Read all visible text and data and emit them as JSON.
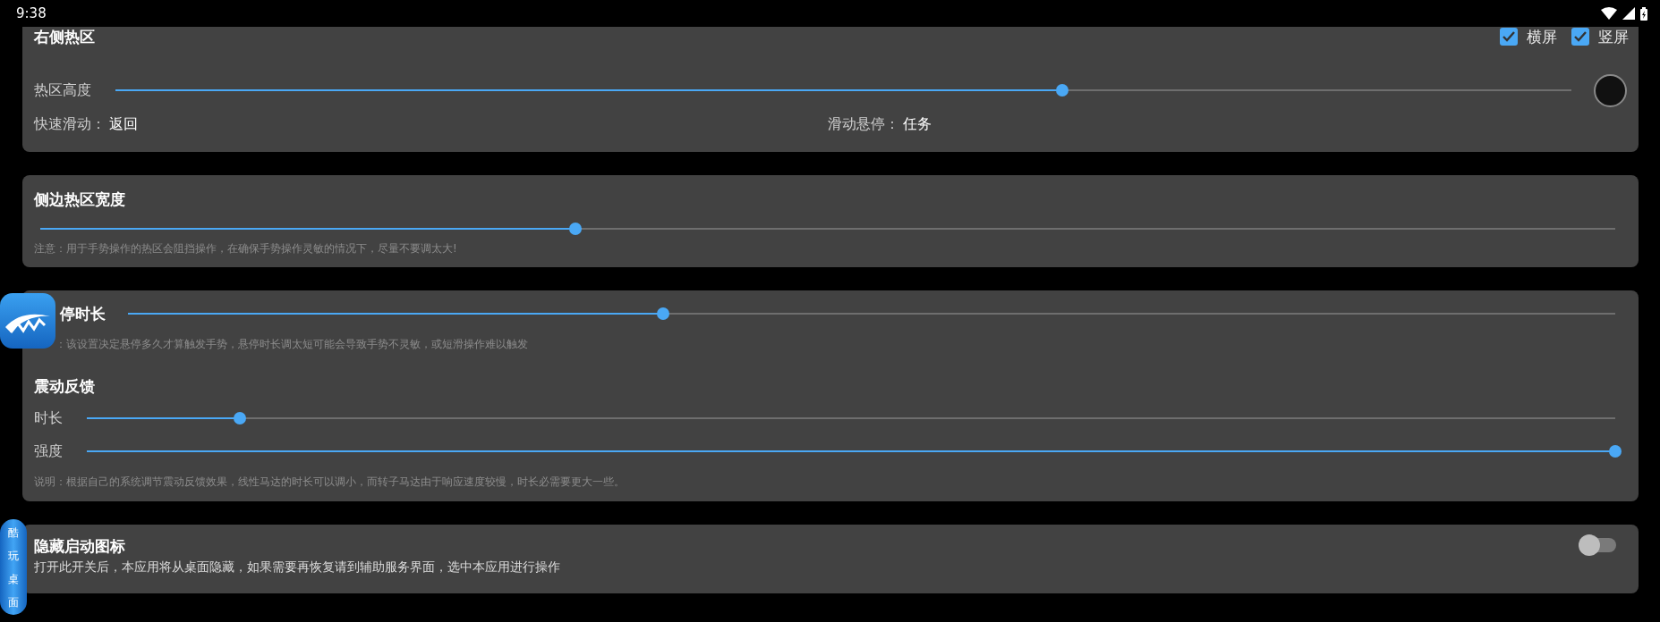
{
  "status_bar": {
    "time": "9:38"
  },
  "cards": [
    {
      "rows": [
        {
          "kind": "header",
          "title": "右侧热区",
          "checkboxes": [
            {
              "label": "横屏",
              "checked": true
            },
            {
              "label": "竖屏",
              "checked": true
            }
          ]
        },
        {
          "kind": "slider",
          "label": "热区高度",
          "level": 0.65,
          "swatch": true
        },
        {
          "kind": "pairs",
          "items": [
            {
              "label": "快速滑动：",
              "value": "返回"
            },
            {
              "label": "滑动悬停：",
              "value": "任务"
            }
          ]
        }
      ]
    },
    {
      "rows": [
        {
          "kind": "title",
          "text": "侧边热区宽度"
        },
        {
          "kind": "slider",
          "level": 0.34
        },
        {
          "kind": "note",
          "text": "注意：用于手势操作的热区会阻挡操作，在确保手势操作灵敏的情况下，尽量不要调太大!"
        }
      ]
    },
    {
      "rows": [
        {
          "kind": "title-slider",
          "title": "停时长",
          "level": 0.36
        },
        {
          "kind": "note",
          "text": "：该设置决定悬停多久才算触发手势，悬停时长调太短可能会导致手势不灵敏，或短滑操作难以触发"
        },
        {
          "kind": "title",
          "text": "震动反馈"
        },
        {
          "kind": "slider",
          "label": "时长",
          "level": 0.1
        },
        {
          "kind": "slider",
          "label": "强度",
          "level": 1.0
        },
        {
          "kind": "note",
          "text": "说明：根据自己的系统调节震动反馈效果，线性马达的时长可以调小，而转子马达由于响应速度较慢，时长必需要更大一些。"
        }
      ]
    },
    {
      "rows": [
        {
          "kind": "toggle",
          "title": "隐藏启动图标",
          "text": "打开此开关后，本应用将从桌面隐藏，如果需要再恢复请到辅助服务界面，选中本应用进行操作",
          "on": false
        }
      ]
    }
  ],
  "side_tab": {
    "label": "酷玩桌面"
  }
}
